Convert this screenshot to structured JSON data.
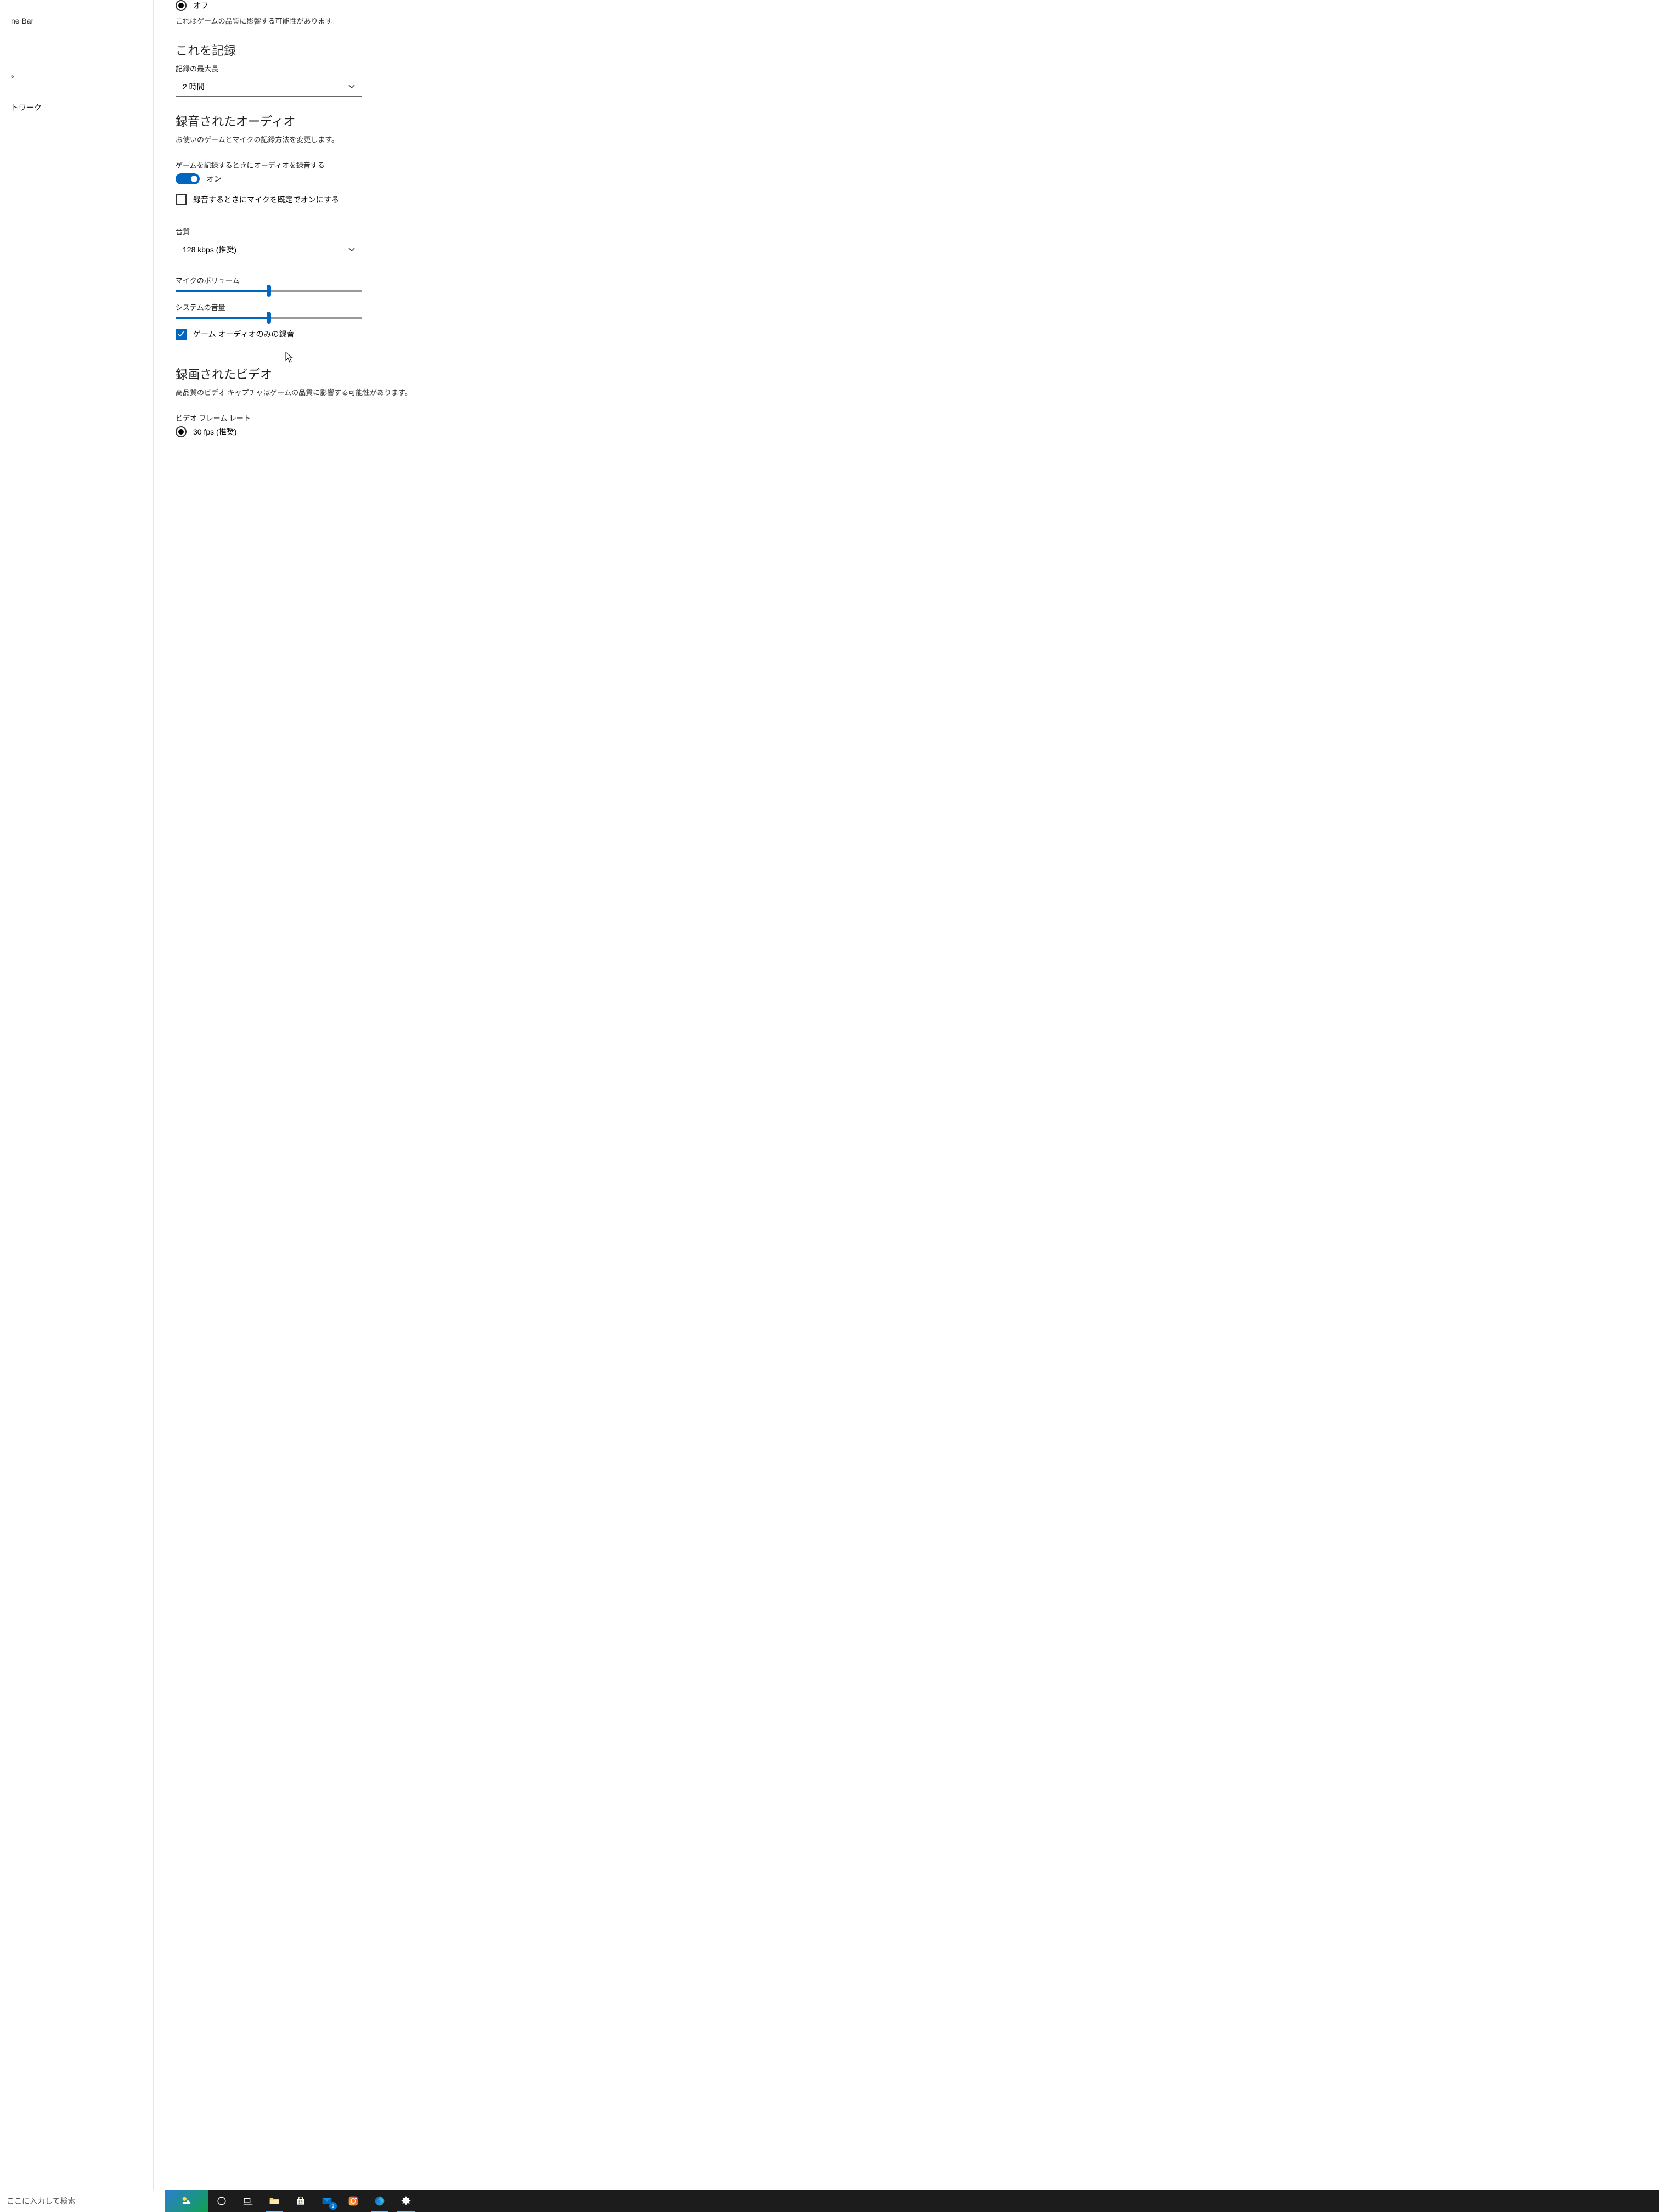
{
  "sidebar": {
    "items": [
      {
        "label": "ne Bar"
      },
      {
        "label": "。"
      },
      {
        "label": "トワーク"
      }
    ]
  },
  "top_toggle": {
    "off_label": "オフ",
    "desc": "これはゲームの品質に影響する可能性があります。"
  },
  "record_this": {
    "heading": "これを記録",
    "max_length_label": "記録の最大長",
    "dropdown_value": "2 時間"
  },
  "recorded_audio": {
    "heading": "録音されたオーディオ",
    "desc": "お使いのゲームとマイクの記録方法を変更します。",
    "record_audio_label": "ゲームを記録するときにオーディオを録音する",
    "toggle_state": "オン",
    "mic_default_label": "録音するときにマイクを既定でオンにする",
    "quality_label": "音質",
    "quality_value": "128 kbps (推奨)",
    "mic_volume_label": "マイクのボリューム",
    "mic_volume_pct": 50,
    "system_volume_label": "システムの音量",
    "system_volume_pct": 50,
    "game_audio_only_label": "ゲーム オーディオのみの録音"
  },
  "recorded_video": {
    "heading": "録画されたビデオ",
    "desc": "高品質のビデオ キャプチャはゲームの品質に影響する可能性があります。",
    "framerate_label": "ビデオ フレーム レート",
    "framerate_value": "30 fps (推奨)"
  },
  "taskbar": {
    "search_placeholder": "ここに入力して検索",
    "mail_badge": "2"
  }
}
